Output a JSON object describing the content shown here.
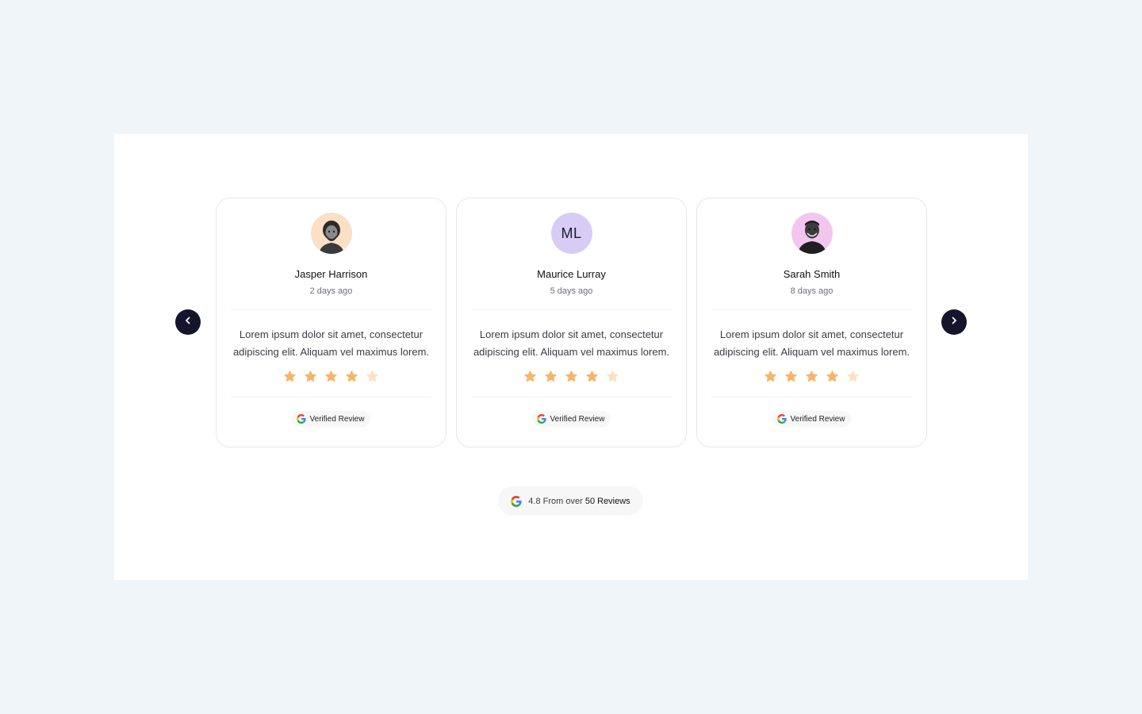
{
  "navigation": {
    "prev_icon": "chevron-left-icon",
    "next_icon": "chevron-right-icon"
  },
  "reviews": [
    {
      "name": "Jasper Harrison",
      "date": "2 days ago",
      "text": "Lorem ipsum dolor sit amet, consectetur adipiscing elit. Aliquam vel maximus lorem.",
      "rating": 4,
      "avatar_type": "photo",
      "avatar_bg": "#fbe0c6",
      "badge": "Verified Review"
    },
    {
      "name": "Maurice Lurray",
      "date": "5 days ago",
      "text": "Lorem ipsum dolor sit amet, consectetur adipiscing elit. Aliquam vel maximus lorem.",
      "rating": 4,
      "avatar_type": "initials",
      "initials": "ML",
      "avatar_bg": "#d9ccf4",
      "badge": "Verified Review"
    },
    {
      "name": "Sarah Smith",
      "date": "8 days ago",
      "text": "Lorem ipsum dolor sit amet, consectetur adipiscing elit. Aliquam vel maximus lorem.",
      "rating": 4,
      "avatar_type": "photo",
      "avatar_bg": "#f3c6ef",
      "badge": "Verified Review"
    }
  ],
  "rating_max": 5,
  "summary": {
    "prefix": "4.8 From over",
    "highlight": "50 Reviews",
    "icon": "google-icon"
  },
  "colors": {
    "star_filled": "#f8b56a",
    "star_empty": "#fde2c0",
    "nav_button": "#14142b",
    "page_bg": "#f0f5f9"
  }
}
